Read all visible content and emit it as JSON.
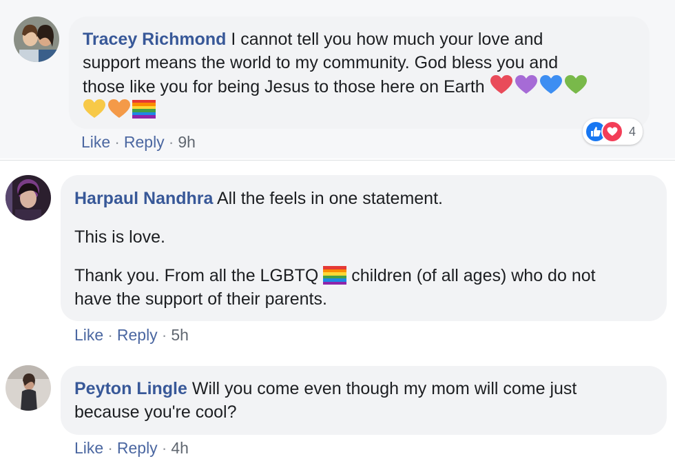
{
  "comments": [
    {
      "author": "Tracey Richmond",
      "text_line1": " I cannot tell you how much your love and",
      "text_line2": "support means the world to my community. God bless you and",
      "text_line3": "those like you for being Jesus to those here on Earth",
      "emoji_line3": [
        "red-heart",
        "purple-heart",
        "blue-heart",
        "green-heart"
      ],
      "emoji_line4": [
        "yellow-heart",
        "orange-heart",
        "rainbow-flag"
      ],
      "like_label": "Like",
      "reply_label": "Reply",
      "time": "9h",
      "reaction_icons": [
        "like-icon",
        "love-icon"
      ],
      "reaction_count": "4"
    },
    {
      "author": "Harpaul Nandhra",
      "para1": " All the feels in one statement.",
      "para2": "This is love.",
      "para3_before": "Thank you. From all the LGBTQ",
      "para3_after": " children (of all ages) who do not",
      "para3_line2": "have the support of their parents.",
      "like_label": "Like",
      "reply_label": "Reply",
      "time": "5h"
    },
    {
      "author": "Peyton Lingle",
      "text_line1": " Will you come even though my mom will come just",
      "text_line2": "because you're cool?",
      "like_label": "Like",
      "reply_label": "Reply",
      "time": "4h"
    }
  ],
  "colors": {
    "author_link": "#385898",
    "action_link": "#4b67a1",
    "bubble": "#f2f3f5",
    "like_blue": "#1877f2",
    "love_red": "#f33e58"
  }
}
